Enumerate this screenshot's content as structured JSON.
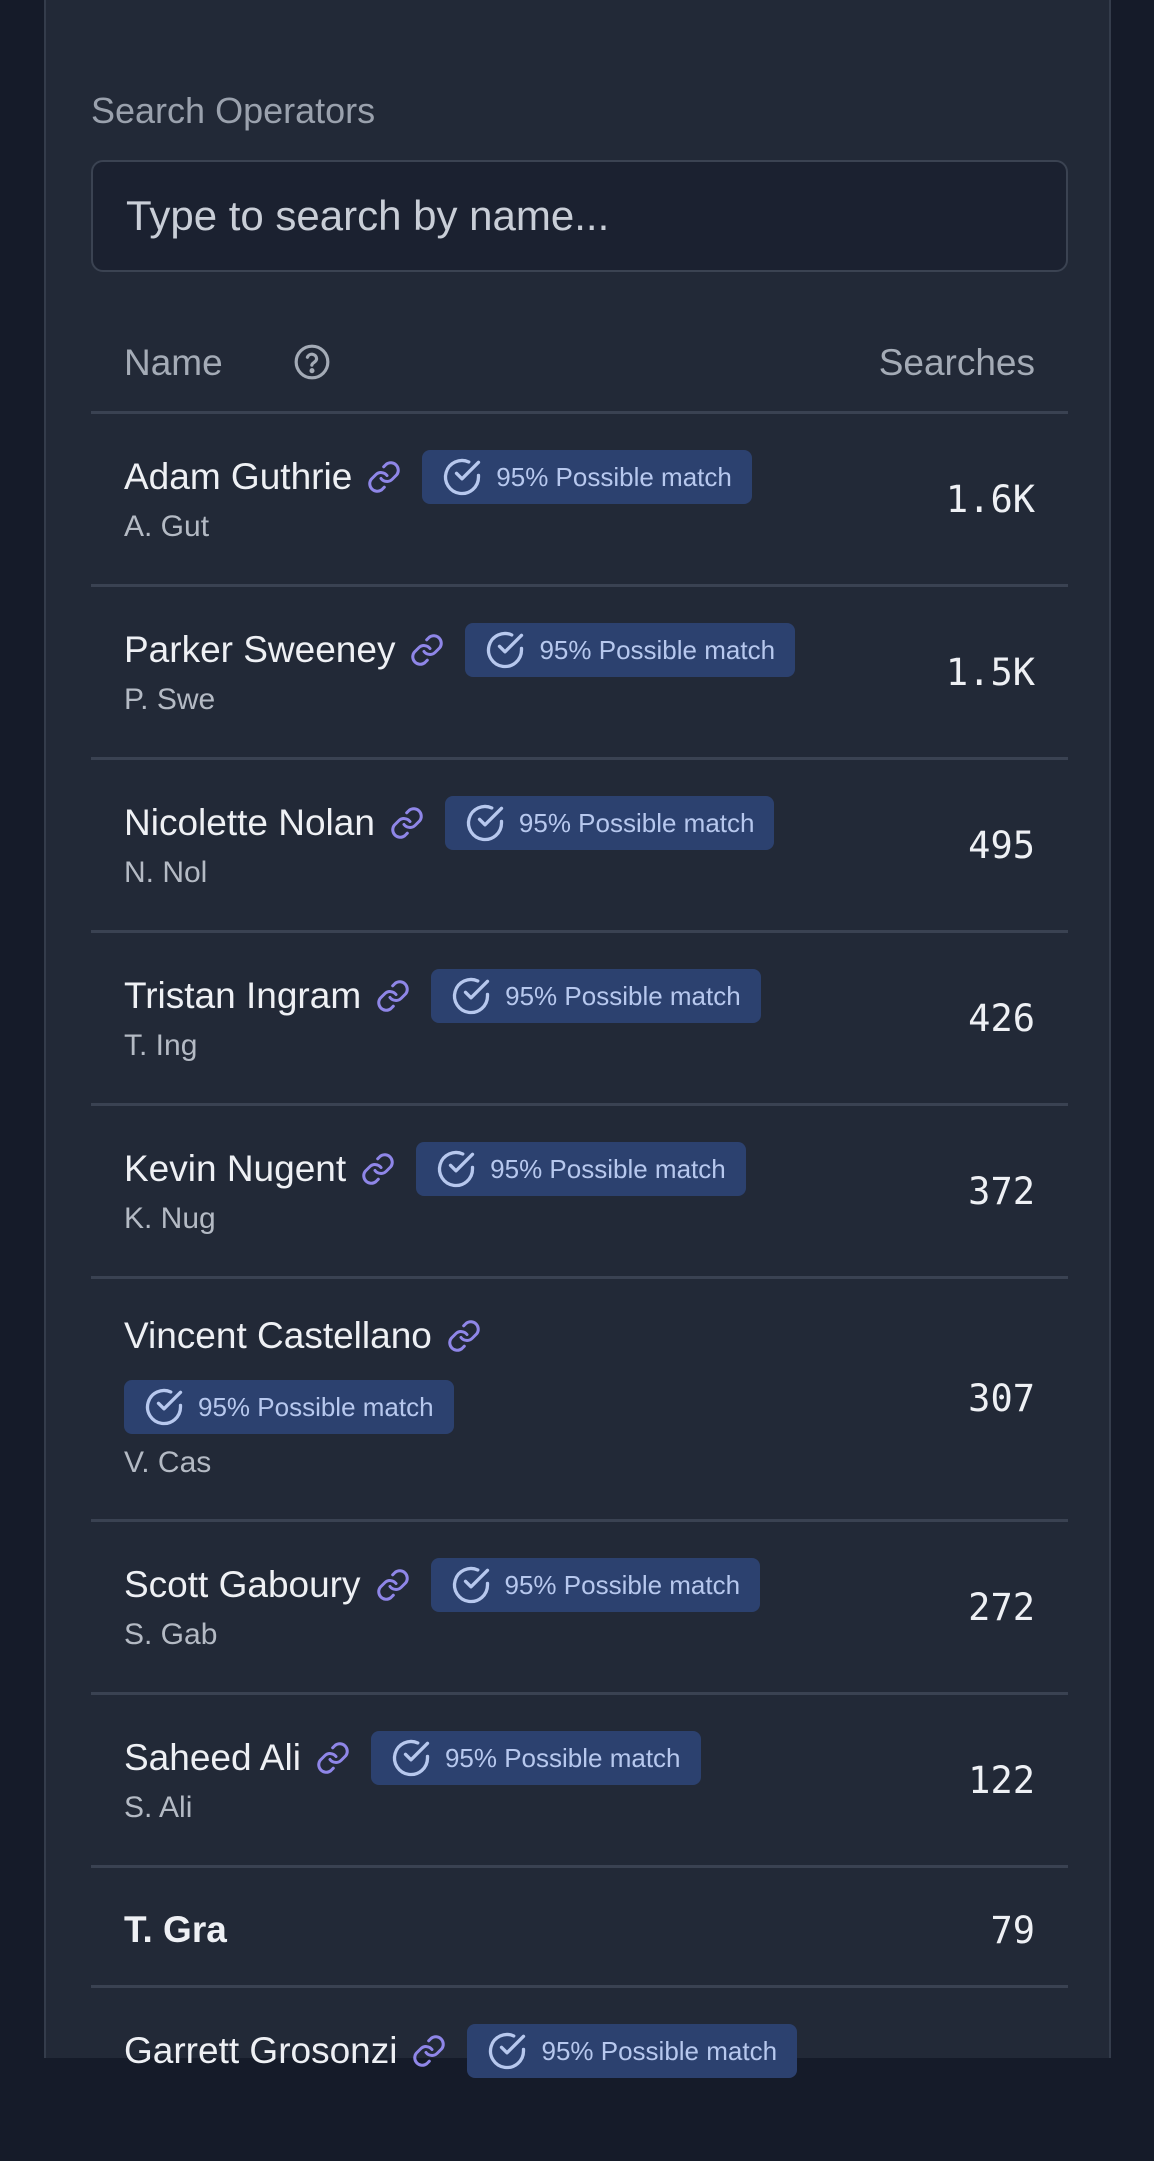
{
  "search": {
    "label": "Search Operators",
    "placeholder": "Type to search by name..."
  },
  "table": {
    "col_name": "Name",
    "col_searches": "Searches",
    "rows": [
      {
        "name": "Adam Guthrie",
        "short": "A. Gut",
        "badge": "95% Possible match",
        "searches": "1.6K"
      },
      {
        "name": "Parker Sweeney",
        "short": "P. Swe",
        "badge": "95% Possible match",
        "searches": "1.5K"
      },
      {
        "name": "Nicolette Nolan",
        "short": "N. Nol",
        "badge": "95% Possible match",
        "searches": "495"
      },
      {
        "name": "Tristan Ingram",
        "short": "T. Ing",
        "badge": "95% Possible match",
        "searches": "426"
      },
      {
        "name": "Kevin Nugent",
        "short": "K. Nug",
        "badge": "95% Possible match",
        "searches": "372"
      },
      {
        "name": "Vincent Castellano",
        "short": "V. Cas",
        "badge": "95% Possible match",
        "searches": "307"
      },
      {
        "name": "Scott Gaboury",
        "short": "S. Gab",
        "badge": "95% Possible match",
        "searches": "272"
      },
      {
        "name": "Saheed Ali",
        "short": "S. Ali",
        "badge": "95% Possible match",
        "searches": "122"
      },
      {
        "name": "",
        "short": "T. Gra",
        "badge": "",
        "searches": "79"
      },
      {
        "name": "Garrett Grosonzi",
        "short": "",
        "badge": "95% Possible match",
        "searches": ""
      }
    ]
  },
  "icons": {
    "help": "help-circle-icon",
    "link": "link-icon",
    "match": "check-circle-icon"
  },
  "colors": {
    "background": "#151b29",
    "panel": "#222937",
    "badge_bg": "#2c416f",
    "badge_text": "#b7c8ee",
    "link_icon": "#8f86e8"
  }
}
